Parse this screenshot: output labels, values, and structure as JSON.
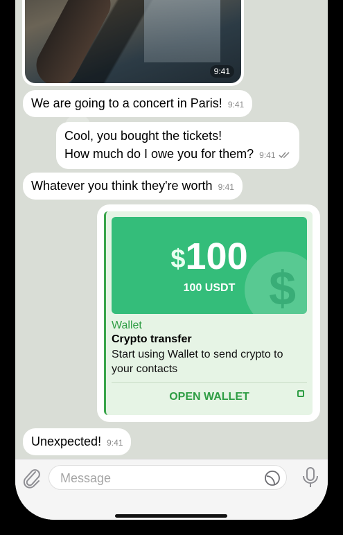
{
  "messages": {
    "photo_time": "9:41",
    "m1": {
      "text": "We are going to a concert in Paris!",
      "time": "9:41"
    },
    "m2": {
      "line1": "Cool, you bought the tickets!",
      "line2": "How much do I owe you for them?",
      "time": "9:41"
    },
    "m3": {
      "text": "Whatever you think they're worth",
      "time": "9:41"
    },
    "m4": {
      "text": "Unexpected!",
      "time": "9:41"
    }
  },
  "wallet_card": {
    "currency_symbol": "$",
    "amount": "100",
    "amount_sub": "100 USDT",
    "bg_symbol": "$",
    "brand": "Wallet",
    "title": "Crypto transfer",
    "description": "Start using Wallet to send crypto to your contacts",
    "button_label": "OPEN WALLET",
    "accent_color": "#34bd7a"
  },
  "composer": {
    "placeholder": "Message"
  },
  "icons": [
    "paperclip-icon",
    "sticker-icon",
    "microphone-icon",
    "double-check-icon",
    "external-link-icon"
  ]
}
